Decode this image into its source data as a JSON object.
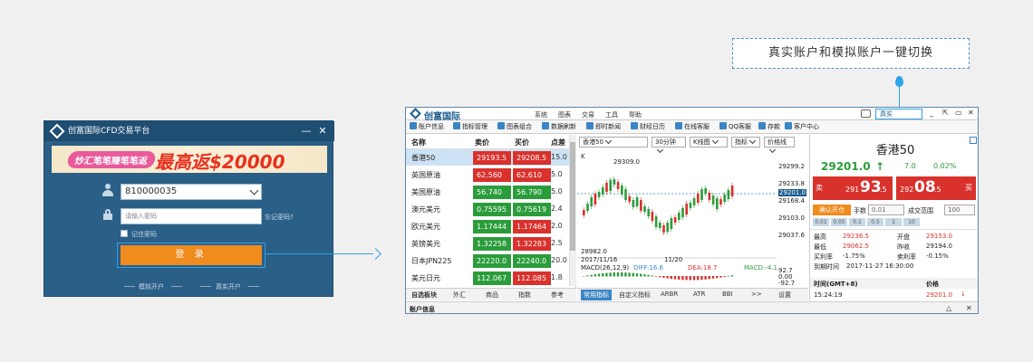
{
  "login": {
    "title": "创富国际CFD交易平台",
    "minimize": "—",
    "close": "✕",
    "banner_left": "炒汇笔笔赚笔笔返",
    "banner_right": "最高返$20000",
    "account": "810000035",
    "password_placeholder": "请输入密码",
    "forgot": "忘记密码?",
    "remember": "记住密码",
    "login_button": "登 录",
    "sim_link": "模拟开户",
    "real_link": "真实开户"
  },
  "callout": {
    "text": "真实账户和模拟账户一键切换"
  },
  "app": {
    "name": "创富国际",
    "menu": [
      "系统",
      "图表",
      "交易",
      "工具",
      "帮助"
    ],
    "account_mode": "真实",
    "title_controls": [
      "_",
      "⇱",
      "▭",
      "✕"
    ],
    "toolbar": [
      "账户信息",
      "指标管理",
      "图表组合",
      "数据刷新",
      "即时新闻",
      "财经日历",
      "在线客服",
      "QQ客服",
      "存款",
      "客户中心"
    ]
  },
  "quotes": {
    "headers": [
      "名称",
      "卖价",
      "买价",
      "点差"
    ],
    "rows": [
      {
        "name": "香港50",
        "bid": "29193.5",
        "ask": "29208.5",
        "spread": "15.0",
        "bid_color": "#d9312c",
        "ask_color": "#d9312c"
      },
      {
        "name": "英国原油",
        "bid": "62.560",
        "ask": "62.610",
        "spread": "5.0",
        "bid_color": "#d9312c",
        "ask_color": "#d9312c"
      },
      {
        "name": "美国原油",
        "bid": "56.740",
        "ask": "56.790",
        "spread": "5.0",
        "bid_color": "#2a9d3a",
        "ask_color": "#2a9d3a"
      },
      {
        "name": "澳元美元",
        "bid": "0.75595",
        "ask": "0.75619",
        "spread": "2.4",
        "bid_color": "#2a9d3a",
        "ask_color": "#2a9d3a"
      },
      {
        "name": "欧元美元",
        "bid": "1.17444",
        "ask": "1.17464",
        "spread": "2.0",
        "bid_color": "#2a9d3a",
        "ask_color": "#d9312c"
      },
      {
        "name": "英镑美元",
        "bid": "1.32258",
        "ask": "1.32283",
        "spread": "2.5",
        "bid_color": "#2a9d3a",
        "ask_color": "#d9312c"
      },
      {
        "name": "日本JPN225",
        "bid": "22220.0",
        "ask": "22240.0",
        "spread": "20.0",
        "bid_color": "#2a9d3a",
        "ask_color": "#2a9d3a"
      },
      {
        "name": "美元日元",
        "bid": "112.067",
        "ask": "112.085",
        "spread": "1.8",
        "bid_color": "#2a9d3a",
        "ask_color": "#d9312c"
      }
    ],
    "tabs": [
      "自选板块",
      "外汇",
      "商品",
      "指数",
      "参考"
    ]
  },
  "chart": {
    "symbol": "香港50",
    "period": "30分钟",
    "chart_type": "K线图",
    "indicator": "指标",
    "price_line": "价格线",
    "k_label": "K",
    "high_label": "29309.0",
    "low_label": "28982.0",
    "date_left": "2017/11/16",
    "date_right": "11/20",
    "macd": "MACD(26,12,9)",
    "diff": "DIFF:16.6",
    "dea": "DEA:18.7",
    "macd_val": "MACD:-4.1",
    "y_labels": [
      "29299.2",
      "29233.8",
      "29201.0",
      "29168.4",
      "29103.0",
      "29037.6"
    ],
    "macd_y": [
      "92.7",
      "0.00",
      "-92.7"
    ],
    "tabs": [
      "常用指标",
      "自定义指标",
      "ARBR",
      "ATR",
      "BBI",
      ">>",
      "设置"
    ]
  },
  "panel": {
    "title": "香港50",
    "price": "29201.0",
    "change": "7.0",
    "pct": "0.02%",
    "sell_label": "卖",
    "sell_small": "291",
    "sell_big": "93",
    "sell_tail": ".5",
    "buy_small": "292",
    "buy_big": "08",
    "buy_tail": ".5",
    "buy_label": "买",
    "open_btn": "确认开仓",
    "lots_label": "手数",
    "lots_value": "0.01",
    "slip_label": "成交范围",
    "slip_value": "100",
    "chips": [
      "0.01",
      "0.05",
      "0.1",
      "0.5",
      "1",
      "10"
    ],
    "stats": [
      {
        "k1": "最高",
        "v1": "29236.5",
        "k2": "开盘",
        "v2": "29153.0"
      },
      {
        "k1": "最低",
        "v1": "29062.5",
        "k2": "昨收",
        "v2": "29194.0"
      },
      {
        "k1": "买利率",
        "v1": "-1.75%",
        "k2": "卖利率",
        "v2": "-0.15%"
      }
    ],
    "expiry_label": "到期时间",
    "expiry_value": "2017-11-27 16:30:00",
    "time_head": "时间(GMT+8)",
    "price_head": "价格",
    "last_time": "15:24:19",
    "last_price": "29201.0"
  },
  "status": {
    "text": "账户信息"
  }
}
